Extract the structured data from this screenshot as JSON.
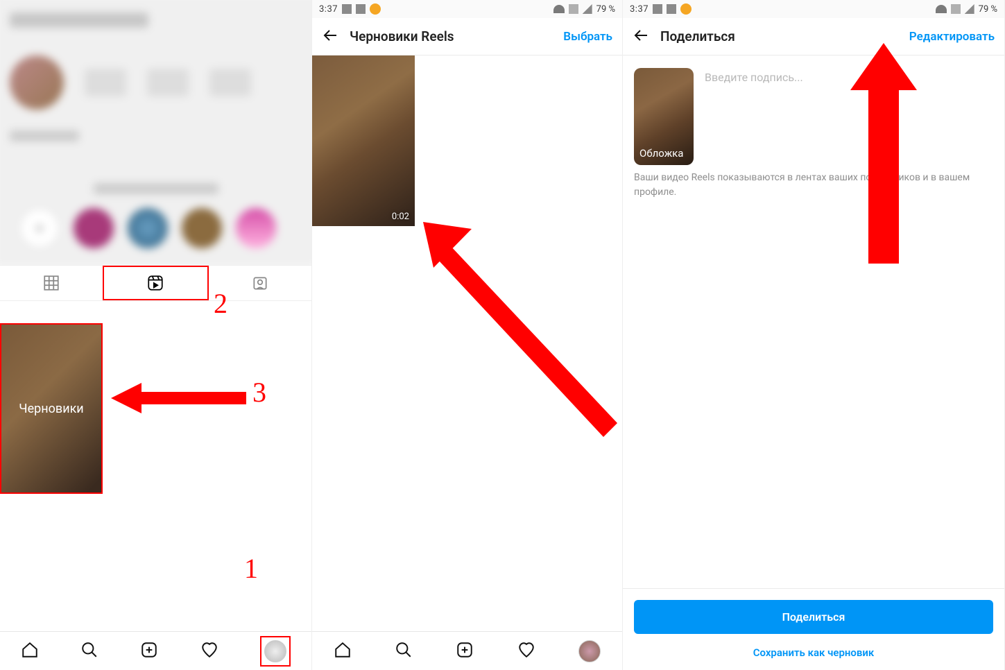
{
  "status": {
    "time": "3:37",
    "battery": "79 %"
  },
  "panel1": {
    "drafts_label": "Черновики",
    "annotation1": "1",
    "annotation2": "2",
    "annotation3": "3"
  },
  "panel2": {
    "title": "Черновики Reels",
    "select_action": "Выбрать",
    "clip_duration": "0:02"
  },
  "panel3": {
    "title": "Поделиться",
    "edit_action": "Редактировать",
    "cover_label": "Обложка",
    "caption_placeholder": "Введите подпись...",
    "info_text": "Ваши видео Reels показываются в лентах ваших подписчиков и в вашем профиле.",
    "share_button": "Поделиться",
    "save_draft": "Сохранить как черновик"
  }
}
